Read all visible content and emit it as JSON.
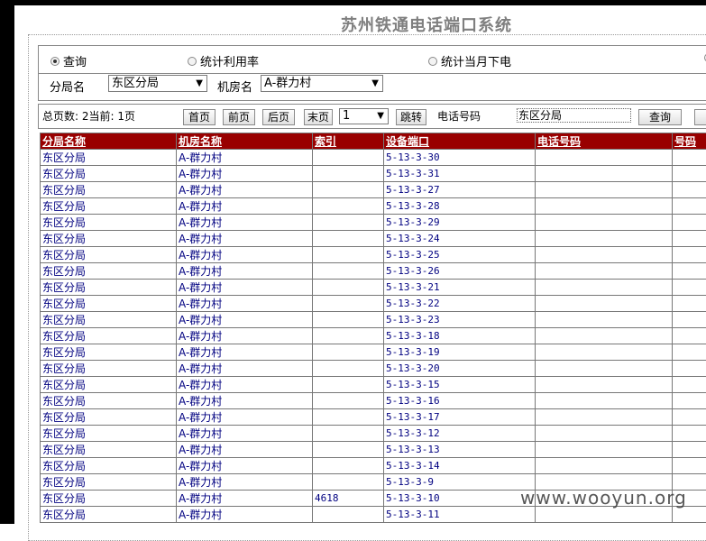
{
  "title": "苏州铁通电话端口系统",
  "radios": [
    {
      "label": "查询",
      "checked": true
    },
    {
      "label": "统计利用率",
      "checked": false
    },
    {
      "label": "统计当月下电",
      "checked": false
    }
  ],
  "filters": {
    "branch_label": "分局名",
    "branch_value": "东区分局",
    "room_label": "机房名",
    "room_value": "A-群力村"
  },
  "pager": {
    "info": "总页数: 2当前: 1页",
    "first": "首页",
    "prev": "前页",
    "next": "后页",
    "last": "末页",
    "page_value": "1",
    "jump": "跳转",
    "phone_label": "电话号码",
    "phone_value": "东区分局",
    "query": "查询"
  },
  "table": {
    "headers": [
      "分局名称",
      "机房名称",
      "索引",
      "设备端口",
      "电话号码",
      "号码"
    ],
    "rows": [
      [
        "东区分局",
        "A-群力村",
        "",
        "5-13-3-30",
        "",
        ""
      ],
      [
        "东区分局",
        "A-群力村",
        "",
        "5-13-3-31",
        "",
        ""
      ],
      [
        "东区分局",
        "A-群力村",
        "",
        "5-13-3-27",
        "",
        ""
      ],
      [
        "东区分局",
        "A-群力村",
        "",
        "5-13-3-28",
        "",
        ""
      ],
      [
        "东区分局",
        "A-群力村",
        "",
        "5-13-3-29",
        "",
        ""
      ],
      [
        "东区分局",
        "A-群力村",
        "",
        "5-13-3-24",
        "",
        ""
      ],
      [
        "东区分局",
        "A-群力村",
        "",
        "5-13-3-25",
        "",
        ""
      ],
      [
        "东区分局",
        "A-群力村",
        "",
        "5-13-3-26",
        "",
        ""
      ],
      [
        "东区分局",
        "A-群力村",
        "",
        "5-13-3-21",
        "",
        ""
      ],
      [
        "东区分局",
        "A-群力村",
        "",
        "5-13-3-22",
        "",
        ""
      ],
      [
        "东区分局",
        "A-群力村",
        "",
        "5-13-3-23",
        "",
        ""
      ],
      [
        "东区分局",
        "A-群力村",
        "",
        "5-13-3-18",
        "",
        ""
      ],
      [
        "东区分局",
        "A-群力村",
        "",
        "5-13-3-19",
        "",
        ""
      ],
      [
        "东区分局",
        "A-群力村",
        "",
        "5-13-3-20",
        "",
        ""
      ],
      [
        "东区分局",
        "A-群力村",
        "",
        "5-13-3-15",
        "",
        ""
      ],
      [
        "东区分局",
        "A-群力村",
        "",
        "5-13-3-16",
        "",
        ""
      ],
      [
        "东区分局",
        "A-群力村",
        "",
        "5-13-3-17",
        "",
        ""
      ],
      [
        "东区分局",
        "A-群力村",
        "",
        "5-13-3-12",
        "",
        ""
      ],
      [
        "东区分局",
        "A-群力村",
        "",
        "5-13-3-13",
        "",
        ""
      ],
      [
        "东区分局",
        "A-群力村",
        "",
        "5-13-3-14",
        "",
        ""
      ],
      [
        "东区分局",
        "A-群力村",
        "",
        "5-13-3-9",
        "",
        ""
      ],
      [
        "东区分局",
        "A-群力村",
        "4618",
        "5-13-3-10",
        "",
        ""
      ],
      [
        "东区分局",
        "A-群力村",
        "",
        "5-13-3-11",
        "",
        ""
      ]
    ]
  },
  "watermark": "www.wooyun.org",
  "colors": {
    "header_bg": "#990000",
    "cell_text": "#000080",
    "title": "#7f7f7f"
  }
}
